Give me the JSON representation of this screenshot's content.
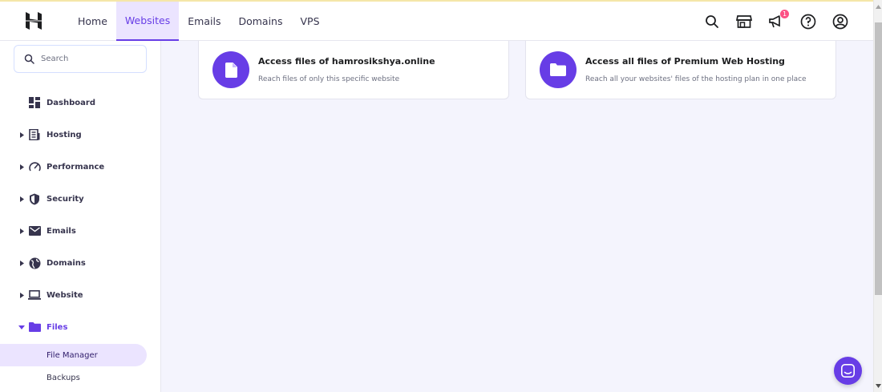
{
  "nav": {
    "items": [
      {
        "label": "Home"
      },
      {
        "label": "Websites"
      },
      {
        "label": "Emails"
      },
      {
        "label": "Domains"
      },
      {
        "label": "VPS"
      }
    ],
    "active": "Websites",
    "notification_count": "1"
  },
  "sidebar": {
    "search_placeholder": "Search",
    "items": [
      {
        "label": "Dashboard",
        "icon": "dashboard-icon"
      },
      {
        "label": "Hosting",
        "icon": "hosting-icon"
      },
      {
        "label": "Performance",
        "icon": "speedometer-icon"
      },
      {
        "label": "Security",
        "icon": "shield-icon"
      },
      {
        "label": "Emails",
        "icon": "envelope-icon"
      },
      {
        "label": "Domains",
        "icon": "globe-icon"
      },
      {
        "label": "Website",
        "icon": "laptop-icon"
      },
      {
        "label": "Files",
        "icon": "folder-icon"
      }
    ],
    "sub_items": [
      {
        "label": "File Manager"
      },
      {
        "label": "Backups"
      }
    ]
  },
  "cards": [
    {
      "title": "Access files of hamrosikshya.online",
      "desc": "Reach files of only this specific website",
      "icon": "file-icon"
    },
    {
      "title": "Access all files of Premium Web Hosting",
      "desc": "Reach all your websites' files of the hosting plan in one place",
      "icon": "folder-icon"
    }
  ],
  "colors": {
    "accent": "#673de6",
    "accent_light": "#ebe4ff",
    "text_dark": "#36344d"
  }
}
